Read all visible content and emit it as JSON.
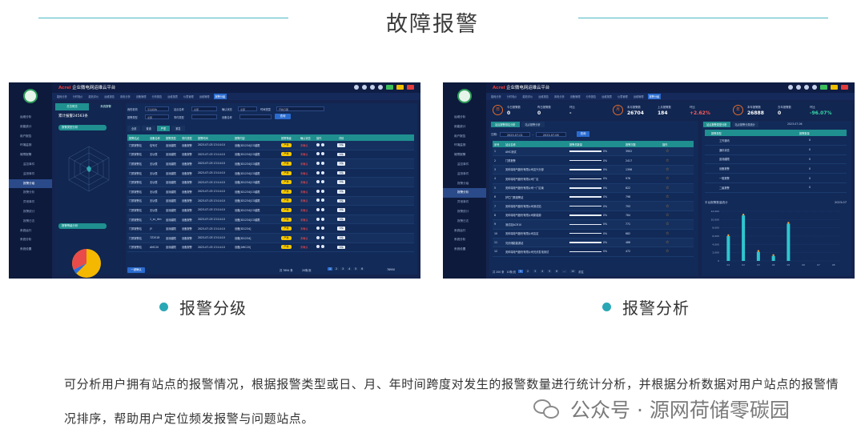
{
  "page": {
    "title": "故障报警"
  },
  "screens": {
    "brand_logo": "Acrel",
    "brand_name": "企业微电网运维云平台",
    "menu": [
      "运维分析",
      "用能统计",
      "用户报告",
      "环境监测",
      "故障报警",
      "监控事件",
      "监测事件",
      "报警分级",
      "报警分析",
      "异常事件",
      "报警统计",
      "报警日志",
      "系统运行",
      "系统分析",
      "系统设置"
    ],
    "nav_tabs": [
      "能耗分析",
      "分时电价",
      "能效评价",
      "运维报告",
      "用电分析",
      "设备管理",
      "分析报告",
      "运维报表",
      "仪表管理",
      "运维管理",
      "报警分级"
    ],
    "alarm_level": {
      "left_tabs": [
        "总览概览",
        "系统报警"
      ],
      "total_label": "累计报警24563条",
      "radar_title": "报警类型分析",
      "pie_title": "报警等级分析",
      "pie_legend": [
        "普通",
        "重要",
        "严重",
        "紧急"
      ],
      "filters": {
        "station_label": "我的机构",
        "station_value": "平台机构",
        "site_label": "站点名称",
        "site_value": "全部",
        "status_label": "确认状态",
        "status_value": "全部",
        "time_label": "时间范围",
        "time_value": "开始日期",
        "type_label": "报警类型",
        "type_value": "全部",
        "event_label": "事件类型",
        "device_label": "设备名称",
        "query_btn": "查询"
      },
      "sub_tabs": [
        "全部",
        "普通",
        "严重",
        "紧急"
      ],
      "columns": [
        "报警站点",
        "设备名称",
        "报警类型",
        "事件类型",
        "报警时间",
        "报警内容",
        "报警等级",
        "确认状态",
        "操作",
        "详情"
      ],
      "rows": [
        {
          "site": "门禁报警站",
          "device": "信号灯",
          "type": "遥测越限",
          "event": "设备报警",
          "time": "2023-07-03 13:14:10",
          "content": "设备[ID1234]CO越限",
          "level": "严重",
          "status": "未确认",
          "op": "详情"
        },
        {
          "site": "门禁报警站",
          "device": "无功表",
          "type": "遥测越限",
          "event": "设备报警",
          "time": "2023-07-03 13:14:10",
          "content": "设备[ID1234]CO越限",
          "level": "严重",
          "status": "未确认",
          "op": "详情"
        },
        {
          "site": "门禁报警站",
          "device": "无功表",
          "type": "遥测越限",
          "event": "设备报警",
          "time": "2023-07-03 13:14:10",
          "content": "设备[ID1234]CO越限",
          "level": "严重",
          "status": "未确认",
          "op": "详情"
        },
        {
          "site": "门禁报警站",
          "device": "无功表",
          "type": "遥测越限",
          "event": "设备报警",
          "time": "2023-07-03 13:14:10",
          "content": "设备[ID1234]CO越限",
          "level": "严重",
          "status": "未确认",
          "op": "详情"
        },
        {
          "site": "门禁报警站",
          "device": "无功表",
          "type": "遥测越限",
          "event": "设备报警",
          "time": "2023-07-03 13:14:10",
          "content": "设备[ID1234]CO越限",
          "level": "严重",
          "status": "未确认",
          "op": "详情"
        },
        {
          "site": "门禁报警站",
          "device": "无功表",
          "type": "遥测越限",
          "event": "设备报警",
          "time": "2023-07-03 13:14:10",
          "content": "设备[ID1234]CO越限",
          "level": "严重",
          "status": "未确认",
          "op": "详情"
        },
        {
          "site": "门禁报警站",
          "device": "无功表",
          "type": "遥测越限",
          "event": "设备报警",
          "time": "2023-07-03 13:14:10",
          "content": "设备[ID1234]CO越限",
          "level": "严重",
          "status": "未确认",
          "op": "详情"
        },
        {
          "site": "门禁报警站",
          "device": "无功表",
          "type": "遥测越限",
          "event": "设备报警",
          "time": "2023-07-03 13:14:10",
          "content": "设备[ID1234]CO越限",
          "level": "严重",
          "status": "未确认",
          "op": "详情"
        },
        {
          "site": "门禁报警站",
          "device": "1_xc_rtm",
          "type": "遥测越限",
          "event": "设备报警",
          "time": "2023-07-03 13:14:10",
          "content": "设备[ID1234]CO越限",
          "level": "严重",
          "status": "未确认",
          "op": "详情"
        },
        {
          "site": "门禁报警站",
          "device": "JY",
          "type": "遥测越限",
          "event": "设备报警",
          "time": "2023-07-03 13:14:10",
          "content": "设备[ID1234]",
          "level": "严重",
          "status": "未确认",
          "op": "详情"
        },
        {
          "site": "门禁报警站",
          "device": "7Z2018",
          "type": "遥测越限",
          "event": "设备报警",
          "time": "2023-07-03 13:14:10",
          "content": "设备[ID1234]",
          "level": "严重",
          "status": "未确认",
          "op": "详情"
        },
        {
          "site": "门禁报警站",
          "device": "AMC20",
          "type": "遥测越限",
          "event": "设备报警",
          "time": "2023-07-03 13:14:10",
          "content": "设备[AMC20]",
          "level": "严重",
          "status": "未确认",
          "op": "详情"
        }
      ],
      "footer": {
        "batch_btn": "一键确认",
        "total": "共 7694 条",
        "page_size": "20条/页",
        "pages": [
          "1",
          "2",
          "3",
          "4",
          "5",
          "6"
        ],
        "last": "78950"
      }
    },
    "alarm_analysis": {
      "stats": [
        {
          "ring": "日",
          "l1": "今日报警数",
          "v1": "0",
          "l2": "昨日报警数",
          "v2": "0",
          "l3": "环比",
          "v3": "-",
          "v3c": ""
        },
        {
          "ring": "月",
          "l1": "本月报警数",
          "v1": "26704",
          "l2": "上月报警数",
          "v2": "184",
          "l3": "环比",
          "v3": "+2.62%",
          "v3c": "red"
        },
        {
          "ring": "年",
          "l1": "本年报警数",
          "v1": "26888",
          "l2": "去年报警数",
          "v2": "0",
          "l3": "环比",
          "v3": "-96.07%",
          "v3c": "green"
        }
      ],
      "left_tabs": [
        "站点报警排名分析",
        "站点报警分析"
      ],
      "date_label": "日期:",
      "date_from": "2023-07-01",
      "date_to": "2023-07-06",
      "query_btn": "查询",
      "columns": [
        "序号",
        "站点名称",
        "报警总数量",
        "报警次数",
        "操作"
      ],
      "rows": [
        {
          "no": "1",
          "name": "AMC测试",
          "pct": "0%",
          "count": "3902"
        },
        {
          "no": "2",
          "name": "门禁报警",
          "pct": "0%",
          "count": "2417"
        },
        {
          "no": "3",
          "name": "安科瑞电气股份有限公司嘉兴分部",
          "pct": "0%",
          "count": "1398"
        },
        {
          "no": "4",
          "name": "安科瑞电气股份有限公司厂区",
          "pct": "0%",
          "count": "976"
        },
        {
          "no": "5",
          "name": "安科瑞电气股份有限公司一厂区南",
          "pct": "0%",
          "count": "822"
        },
        {
          "no": "6",
          "name": "护栏门禁报警站",
          "pct": "0%",
          "count": "798"
        },
        {
          "no": "7",
          "name": "安科瑞电气股份有限公司测试站",
          "pct": "0%",
          "count": "793"
        },
        {
          "no": "8",
          "name": "安科瑞电气股份有限公司新能源",
          "pct": "0%",
          "count": "784"
        },
        {
          "no": "9",
          "name": "测试站ACR10",
          "pct": "0%",
          "count": "771"
        },
        {
          "no": "10",
          "name": "安科瑞电气股份有限公司嘉定",
          "pct": "0%",
          "count": "682"
        },
        {
          "no": "11",
          "name": "光伏储能能源站",
          "pct": "0%",
          "count": "486"
        },
        {
          "no": "12",
          "name": "安科瑞电气股份有限公司光伏发电测试",
          "pct": "0%",
          "count": "472"
        }
      ],
      "pager": {
        "total": "共 200 条",
        "page_size": "10条/页",
        "pages": [
          "1",
          "2",
          "3",
          "4",
          "5",
          "6",
          "...",
          "10"
        ],
        "jump": "前往"
      },
      "right_tabs": [
        "站点报警类型分析",
        "站点报警分类统计"
      ],
      "right_date": "2023-07-06",
      "type_columns": [
        "报警类型",
        "报警数量"
      ],
      "types": [
        {
          "name": "工作通讯",
          "count": "0"
        },
        {
          "name": "通讯状态",
          "count": "0"
        },
        {
          "name": "遥测越限",
          "count": "0"
        },
        {
          "name": "设备报警",
          "count": "0"
        },
        {
          "name": "一般报警",
          "count": "0"
        },
        {
          "name": "二级报警",
          "count": "0"
        }
      ],
      "chart_title": "平台报警数量统计",
      "chart_date": "2023-07"
    }
  },
  "captions": [
    "报警分级",
    "报警分析"
  ],
  "description": "可分析用户拥有站点的报警情况，根据报警类型或日、月、年时间跨度对发生的报警数量进行统计分析，并根据分析数据对用户站点的报警情况排序，帮助用户定位频发报警与问题站点。",
  "watermark": "公众号 · 源网荷储零碳园",
  "chart_data": {
    "type": "bar",
    "title": "平台报警数量统计",
    "categories": [
      "01",
      "02",
      "03",
      "04",
      "05",
      "06",
      "07",
      "08"
    ],
    "values": [
      6000,
      11000,
      2200,
      1200,
      9000,
      0,
      0,
      0
    ],
    "ylim": [
      0,
      12000
    ]
  }
}
